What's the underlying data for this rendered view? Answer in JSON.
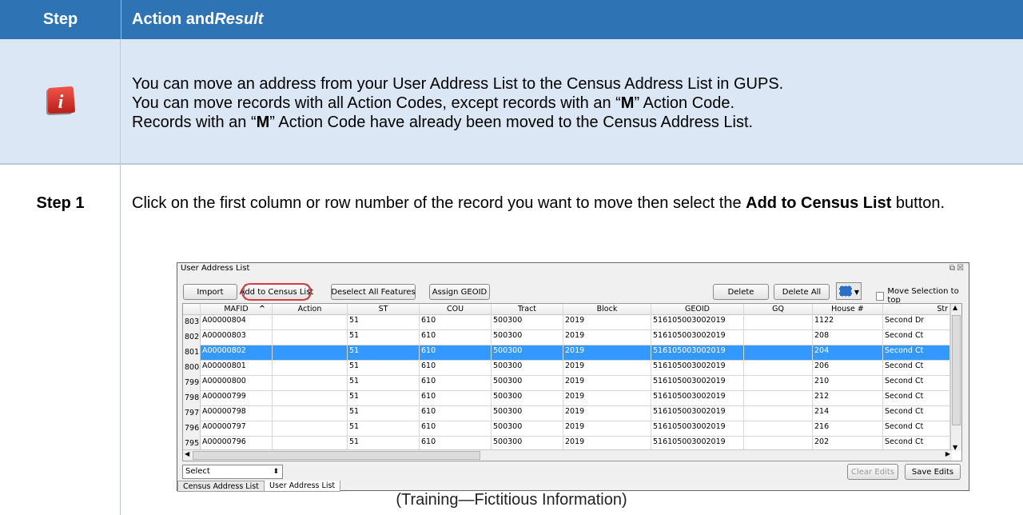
{
  "header": {
    "col1": "Step",
    "col2_a": "Action and ",
    "col2_b": "Result"
  },
  "info_row": {
    "icon": "info-icon",
    "line1": "You can move an address from your User Address List to the Census Address List in GUPS.",
    "line2_a": "You can move records with all Action Codes, except records with an “",
    "line2_b": "M",
    "line2_c": "” Action Code.",
    "line3_a": "Records with an “",
    "line3_b": "M",
    "line3_c": "” Action Code have already been moved to the Census Address List."
  },
  "step1": {
    "label": "Step 1",
    "text_a": "Click on the first column or row number of the record you want to move then select the ",
    "text_b": "Add to Census List",
    "text_c": " button."
  },
  "window": {
    "title": "User Address List",
    "controls": "⧉☒",
    "buttons": {
      "import": "Import",
      "add_census": "Add to Census List",
      "deselect": "Deselect All Features",
      "assign_geoid": "Assign GEOID",
      "delete": "Delete",
      "delete_all": "Delete All",
      "clear_edits": "Clear Edits",
      "save_edits": "Save Edits"
    },
    "move_selection_label": "Move Selection to top",
    "columns": [
      "MAFID",
      "Action",
      "ST",
      "COU",
      "Tract",
      "Block",
      "GEOID",
      "GQ",
      "House #",
      "Str"
    ],
    "sort_indicator": "^",
    "rows": [
      {
        "num": "803",
        "cells": [
          "A00000804",
          "",
          "51",
          "610",
          "500300",
          "2019",
          "516105003002019",
          "",
          "1122",
          "Second Dr"
        ]
      },
      {
        "num": "802",
        "cells": [
          "A00000803",
          "",
          "51",
          "610",
          "500300",
          "2019",
          "516105003002019",
          "",
          "208",
          "Second Ct"
        ]
      },
      {
        "num": "801",
        "cells": [
          "A00000802",
          "",
          "51",
          "610",
          "500300",
          "2019",
          "516105003002019",
          "",
          "204",
          "Second Ct"
        ],
        "selected": true
      },
      {
        "num": "800",
        "cells": [
          "A00000801",
          "",
          "51",
          "610",
          "500300",
          "2019",
          "516105003002019",
          "",
          "206",
          "Second Ct"
        ]
      },
      {
        "num": "799",
        "cells": [
          "A00000800",
          "",
          "51",
          "610",
          "500300",
          "2019",
          "516105003002019",
          "",
          "210",
          "Second Ct"
        ]
      },
      {
        "num": "798",
        "cells": [
          "A00000799",
          "",
          "51",
          "610",
          "500300",
          "2019",
          "516105003002019",
          "",
          "212",
          "Second Ct"
        ]
      },
      {
        "num": "797",
        "cells": [
          "A00000798",
          "",
          "51",
          "610",
          "500300",
          "2019",
          "516105003002019",
          "",
          "214",
          "Second Ct"
        ]
      },
      {
        "num": "796",
        "cells": [
          "A00000797",
          "",
          "51",
          "610",
          "500300",
          "2019",
          "516105003002019",
          "",
          "216",
          "Second Ct"
        ]
      },
      {
        "num": "795",
        "cells": [
          "A00000796",
          "",
          "51",
          "610",
          "500300",
          "2019",
          "516105003002019",
          "",
          "202",
          "Second Ct"
        ]
      }
    ],
    "select_dropdown": "Select",
    "tabs": [
      "Census Address List",
      "User Address List"
    ]
  },
  "caption": "(Training—Fictitious Information)",
  "colors": {
    "header_bg": "#2e74b5",
    "info_bg": "#dbe7f4",
    "selected_row": "#3399ff",
    "ring": "#d63a3a"
  }
}
